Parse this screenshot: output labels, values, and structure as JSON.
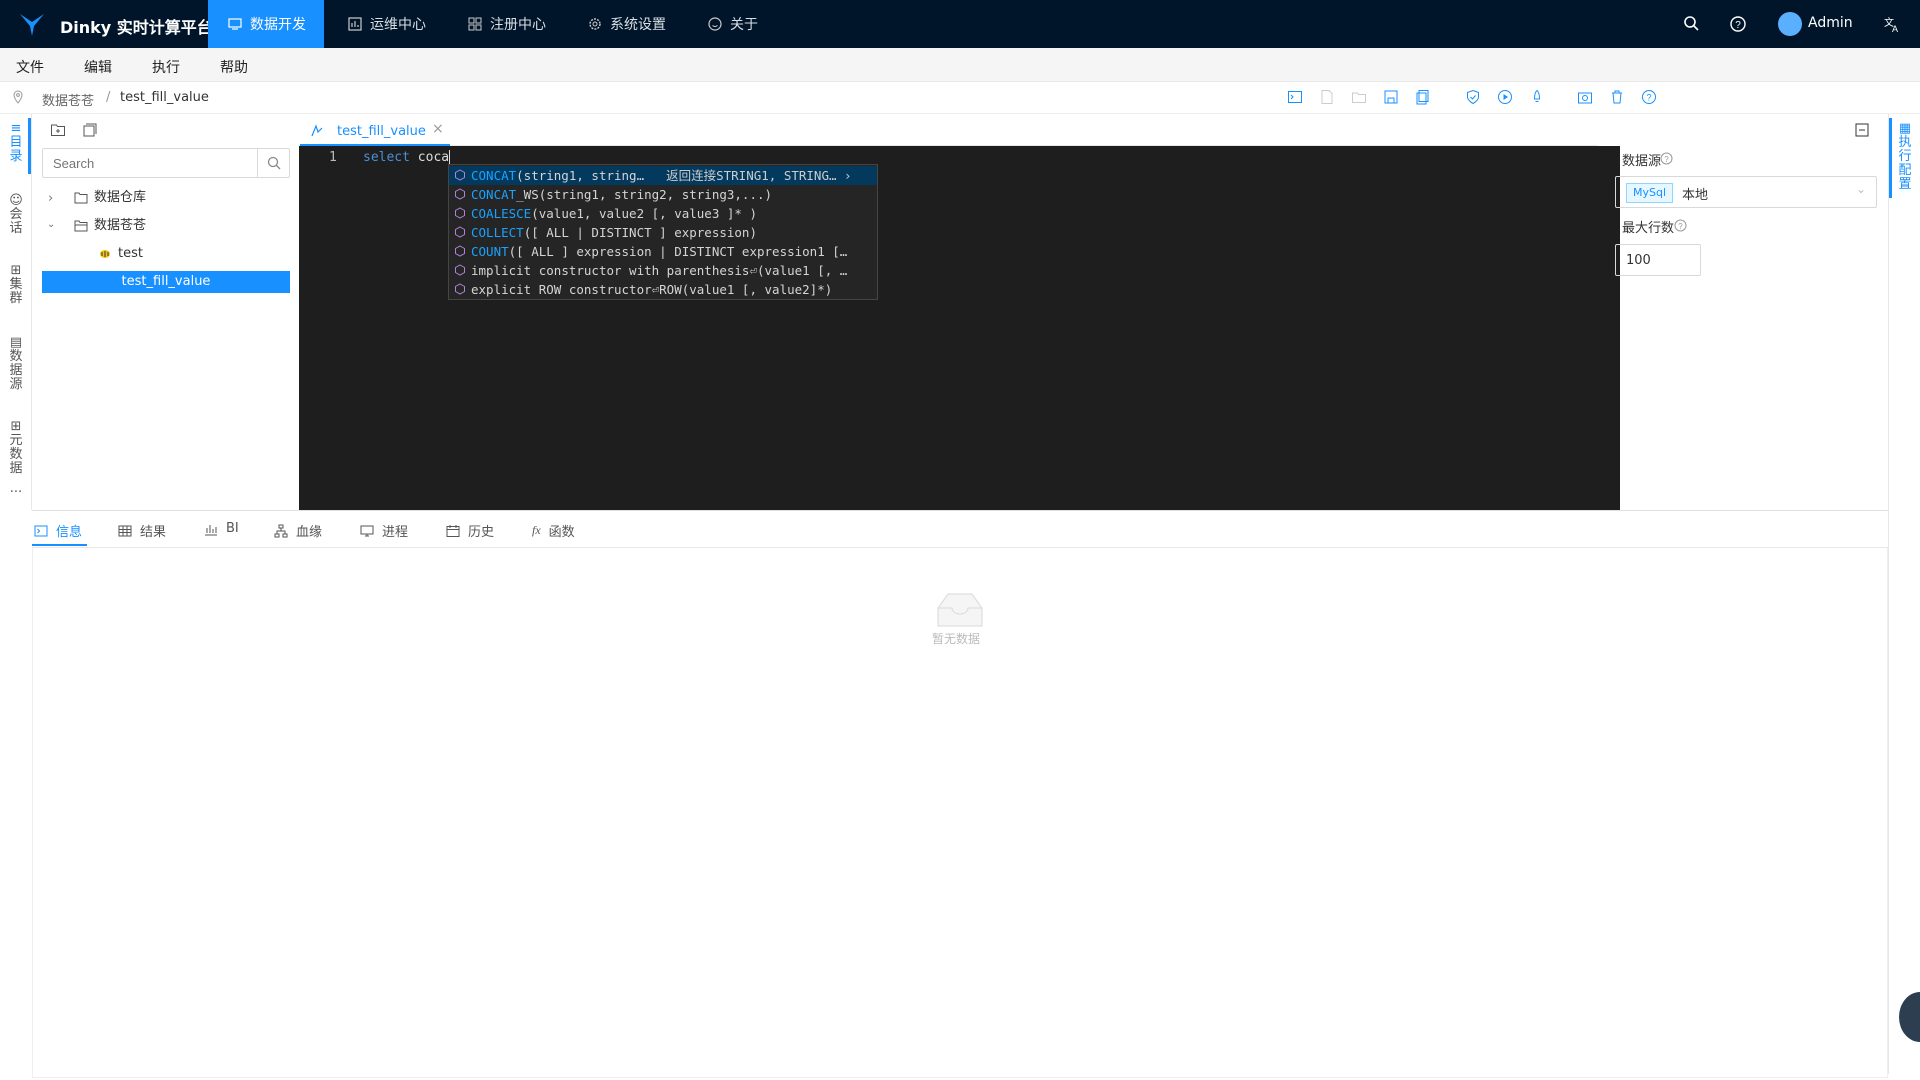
{
  "topbar": {
    "brand": "Dinky 实时计算平台",
    "nav": [
      {
        "label": "数据开发",
        "icon": "monitor-icon",
        "active": true
      },
      {
        "label": "运维中心",
        "icon": "dashboard-icon"
      },
      {
        "label": "注册中心",
        "icon": "apps-icon"
      },
      {
        "label": "系统设置",
        "icon": "gear-icon"
      },
      {
        "label": "关于",
        "icon": "smile-icon"
      }
    ],
    "user": "Admin",
    "accent": "#1890ff",
    "bg": "#001529"
  },
  "menubar": {
    "items": [
      "文件",
      "编辑",
      "执行",
      "帮助"
    ]
  },
  "breadcrumb": {
    "root": "数据苍苍",
    "sep": "/",
    "current": "test_fill_value"
  },
  "leftbar": {
    "tabs": [
      "目录",
      "会话",
      "集群",
      "数据源",
      "元数据"
    ],
    "more": "..."
  },
  "tree": {
    "search_placeholder": "Search",
    "nodes": [
      "数据仓库",
      "数据苍苍",
      "test",
      "test_fill_value"
    ]
  },
  "editor": {
    "tab": "test_fill_value",
    "line": "1",
    "keyword": "select",
    "text": "coca"
  },
  "suggestions": [
    {
      "match": "CONCAT",
      "rest": "(string1, string…",
      "detail": "返回连接STRING1, STRING… ›"
    },
    {
      "match": "CONCAT",
      "rest": "_WS(string1, string2, string3,...)"
    },
    {
      "match": "COALESCE",
      "rest": "(value1, value2 [, value3 ]* )"
    },
    {
      "match": "COLLECT",
      "rest": "([ ALL | DISTINCT ] expression)"
    },
    {
      "match": "COUNT",
      "rest": "([ ALL ] expression | DISTINCT expression1 […"
    },
    {
      "match": "implicit",
      "rest": " constructor with parenthesis⏎(value1 [, …"
    },
    {
      "match": "explicit",
      "rest": " ROW constructor⏎ROW(value1 [, value2]*)"
    }
  ],
  "config": {
    "datasource_label": "数据源",
    "datasource_tag": "MySql",
    "datasource_value": "本地",
    "maxrows_label": "最大行数",
    "maxrows_value": "100",
    "side_tab": "执行配置"
  },
  "bottom": {
    "tabs": [
      {
        "label": "信息",
        "icon": "terminal-icon",
        "active": true
      },
      {
        "label": "结果",
        "icon": "table-icon"
      },
      {
        "label": "BI",
        "icon": "bar-chart-icon"
      },
      {
        "label": "血缘",
        "icon": "lineage-icon"
      },
      {
        "label": "进程",
        "icon": "desktop-icon"
      },
      {
        "label": "历史",
        "icon": "calendar-icon"
      },
      {
        "label": "函数",
        "icon": "function-icon"
      }
    ],
    "empty": "暂无数据"
  }
}
